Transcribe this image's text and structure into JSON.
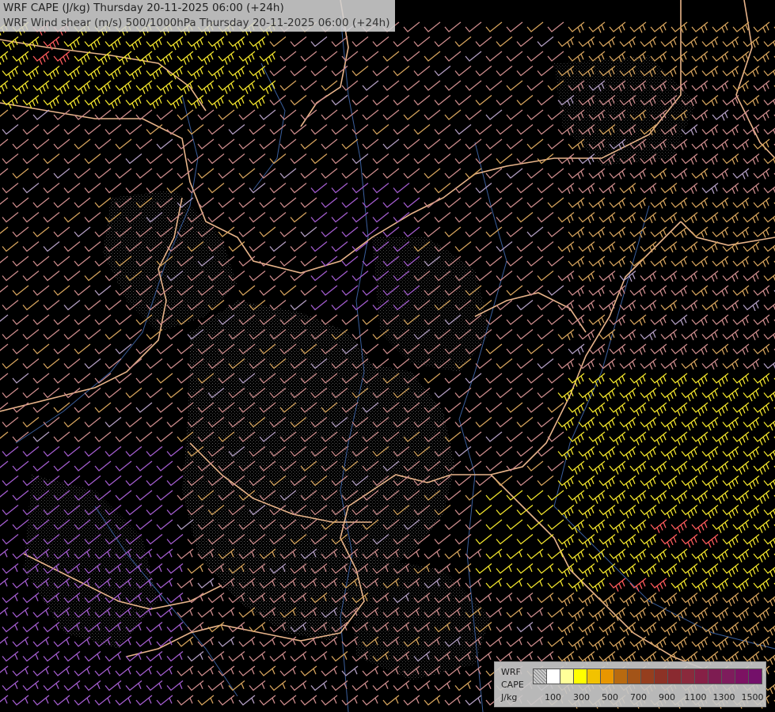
{
  "header": {
    "title_line1": "WRF CAPE (J/kg) Thursday 20-11-2025 06:00 (+24h)",
    "title_line2": "WRF Wind shear (m/s) 500/1000hPa Thursday 20-11-2025 06:00 (+24h)"
  },
  "legend": {
    "model": "WRF",
    "field": "CAPE",
    "unit": "J/kg",
    "colors": [
      "#ffffff",
      "#ffff99",
      "#ffff00",
      "#f2c200",
      "#e89600",
      "#b86a10",
      "#a35418",
      "#953e1e",
      "#8c3226",
      "#8a2a30",
      "#8a2a3c",
      "#862046",
      "#7e1c52",
      "#7e1c5c",
      "#7c1262",
      "#74106a"
    ],
    "ticks": [
      "100",
      "300",
      "500",
      "700",
      "900",
      "1100",
      "1300",
      "1500"
    ]
  },
  "colors": {
    "background": "#000000",
    "borders": "#e8b48a",
    "rivers": "#3a5e9c",
    "hatch": "#5a5a5a",
    "barb_weak": "#b39ec3",
    "barb_low": "#ce8c8c",
    "barb_mid": "#d6a35c",
    "barb_high": "#f2e42c",
    "barb_extreme": "#ff5c5c",
    "barb_purple": "#a35ccf"
  }
}
